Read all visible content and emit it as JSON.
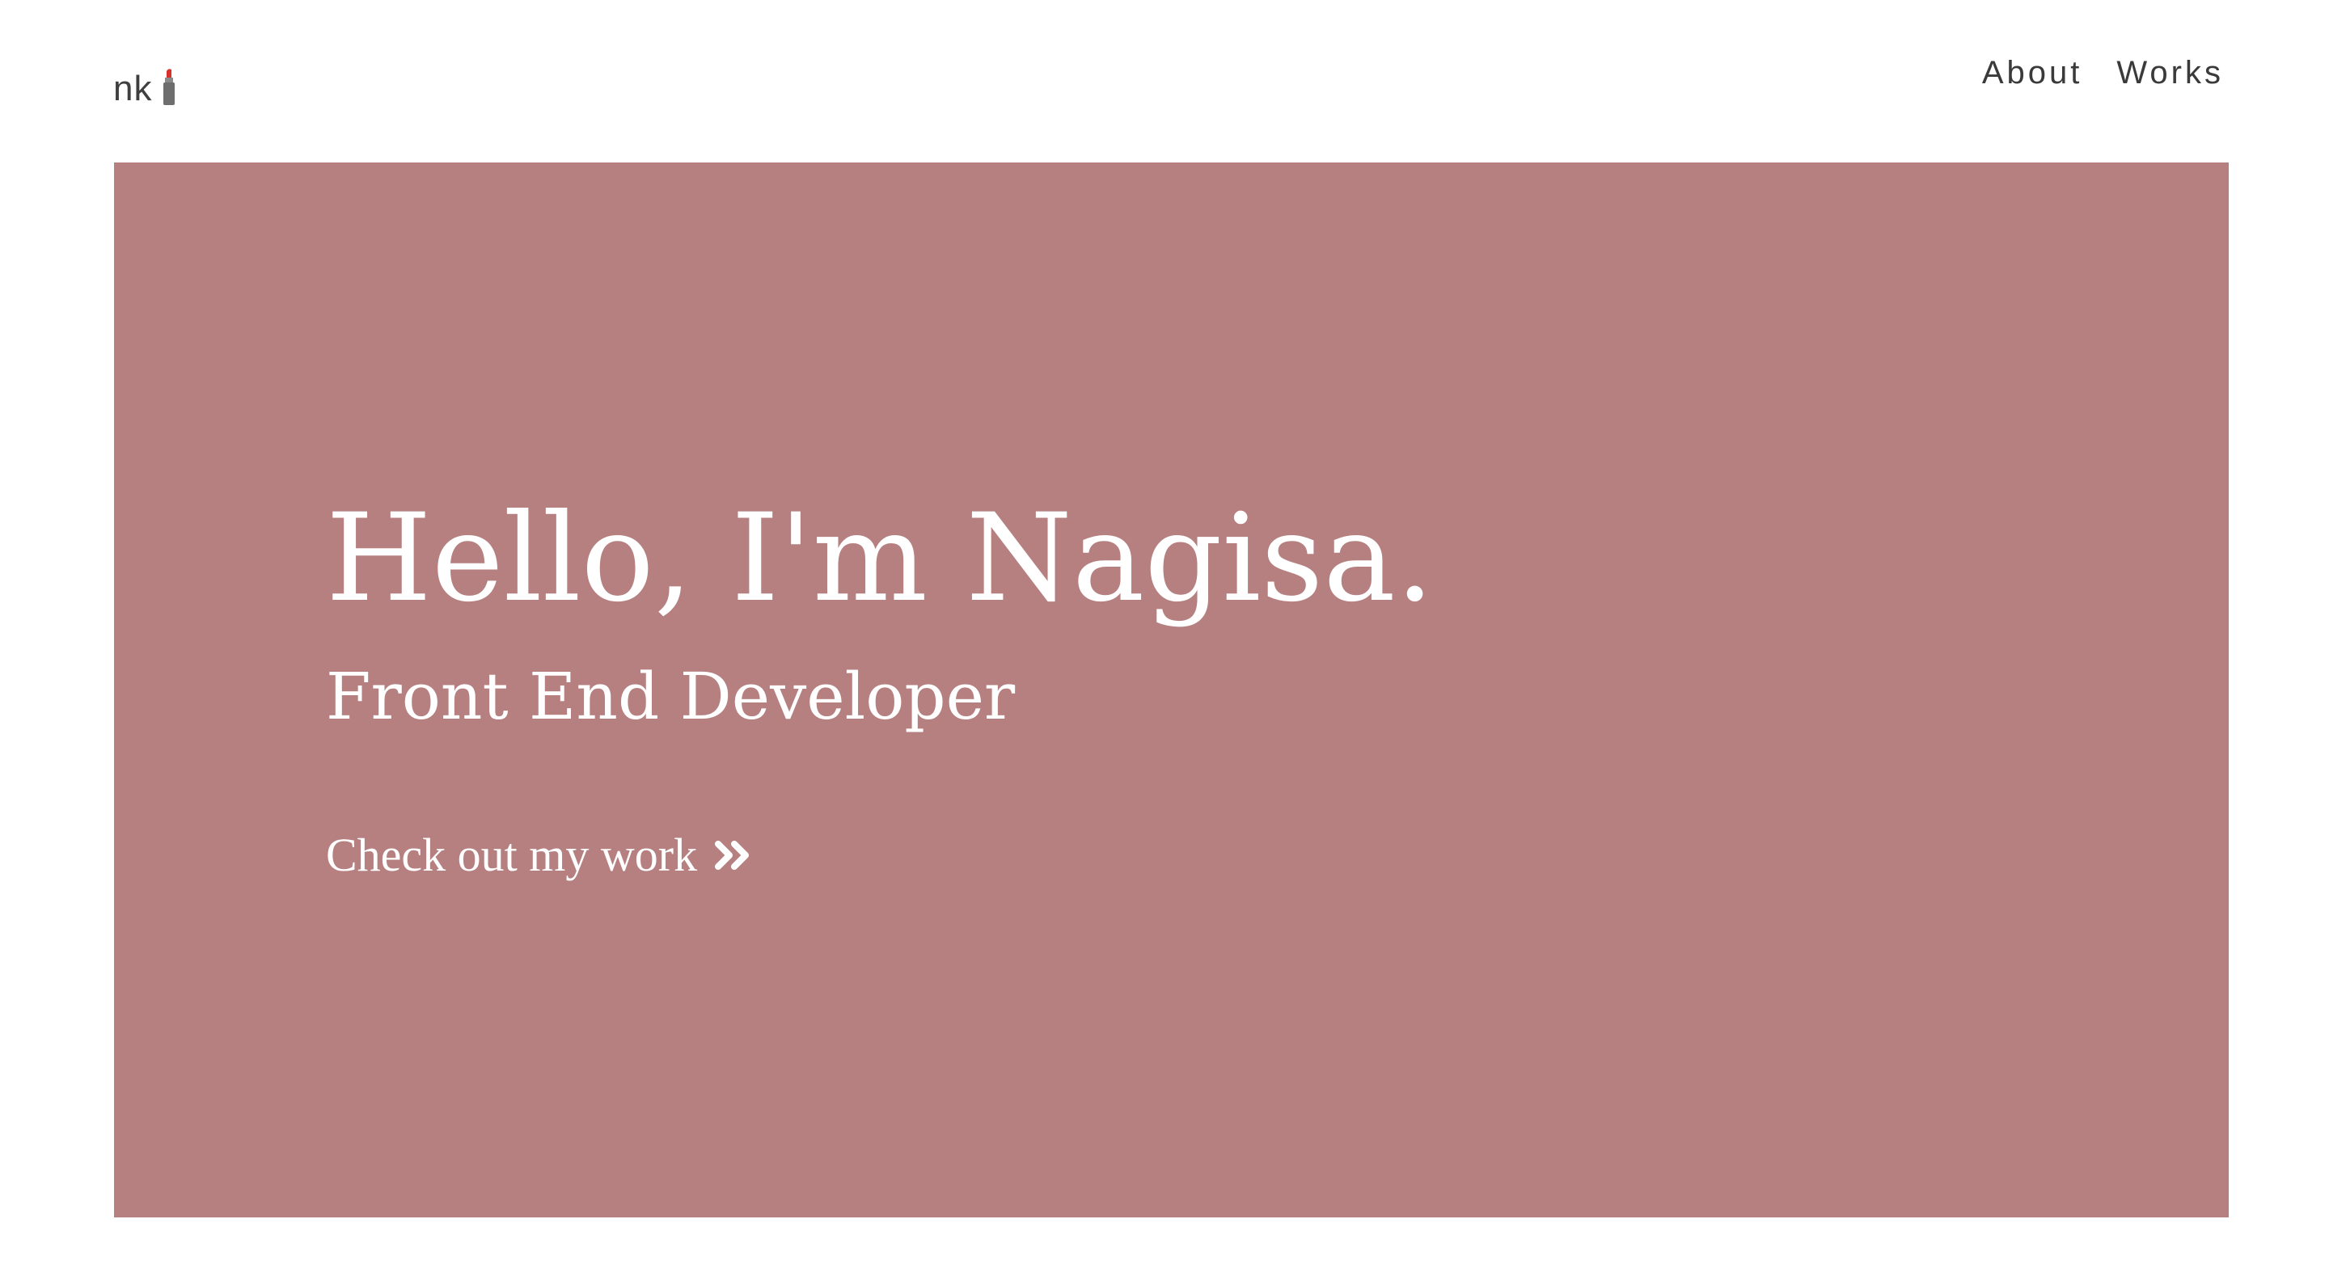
{
  "header": {
    "logo_text": "nk",
    "logo_icon": "lipstick-icon",
    "nav": {
      "about_label": "About",
      "works_label": "Works"
    }
  },
  "hero": {
    "title": "Hello, I'm Nagisa.",
    "subtitle": "Front End Developer",
    "cta_label": "Check out my work",
    "cta_icon": "double-chevron-right-icon"
  },
  "colors": {
    "hero_background": "#b68080",
    "hero_text": "#ffffff",
    "nav_text": "#3a3a3a",
    "lipstick_red": "#d9302c",
    "lipstick_case": "#6e6e6e"
  }
}
